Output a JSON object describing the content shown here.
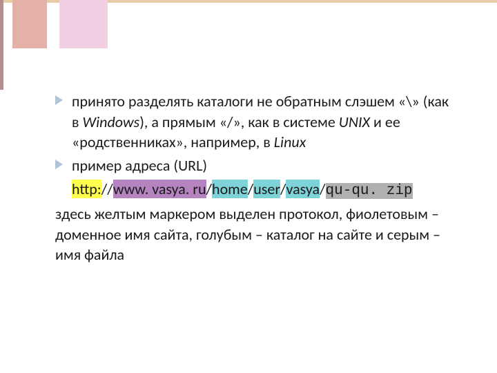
{
  "bullets": {
    "b1_part1": "принято разделять каталоги не обратным слэшем «\\» (как в ",
    "b1_italic1": "Windows",
    "b1_part2": "), а прямым «/», как в системе ",
    "b1_italic2": "UNIX",
    "b1_part3": " и ее «родственниках», например, в ",
    "b1_italic3": "Linux",
    "b2": "пример адреса (URL)"
  },
  "url": {
    "protocol": "http:",
    "sep1": "//",
    "domain": "www. vasya. ru",
    "slash": "/",
    "path1": "home",
    "path2": "user",
    "path3": "vasya",
    "file": "qu-qu. zip"
  },
  "footer": "здесь желтым маркером выделен протокол, фиолетовым – доменное имя сайта, голубым – каталог на сайте и серым – имя файла"
}
